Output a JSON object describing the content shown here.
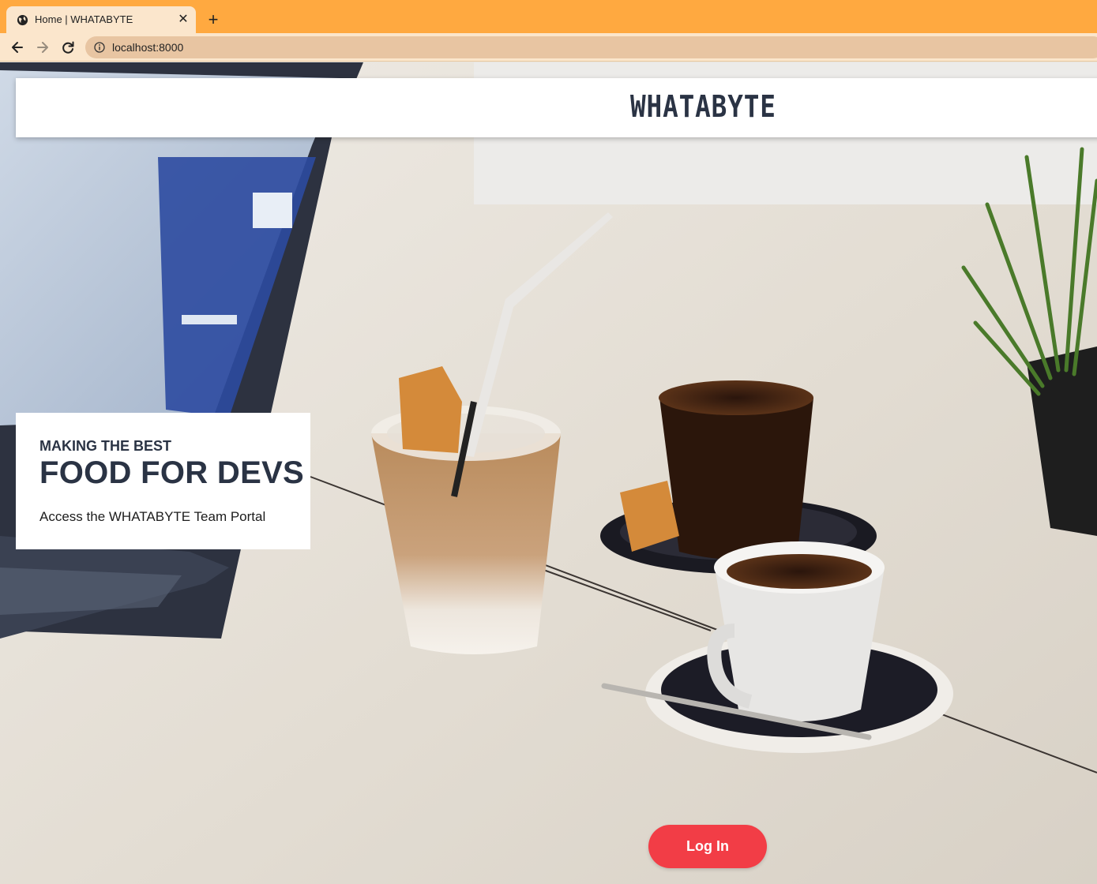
{
  "browser": {
    "tab_title": "Home | WHATABYTE",
    "url": "localhost:8000",
    "new_tab_label": "+",
    "close_label": "✕"
  },
  "header": {
    "brand": "WHATABYTE"
  },
  "promo": {
    "kicker": "MAKING THE BEST",
    "title": "FOOD FOR DEVS",
    "description": "Access the WHATABYTE Team Portal"
  },
  "actions": {
    "login_label": "Log In"
  },
  "colors": {
    "tabbar": "#ffa940",
    "toolbar": "#fbe6cc",
    "brand_text": "#2a3344",
    "login_button": "#f23d46"
  },
  "icons": {
    "tab": "globe-icon",
    "back": "arrow-left-icon",
    "forward": "arrow-right-icon",
    "reload": "reload-icon",
    "site_info": "info-icon"
  }
}
